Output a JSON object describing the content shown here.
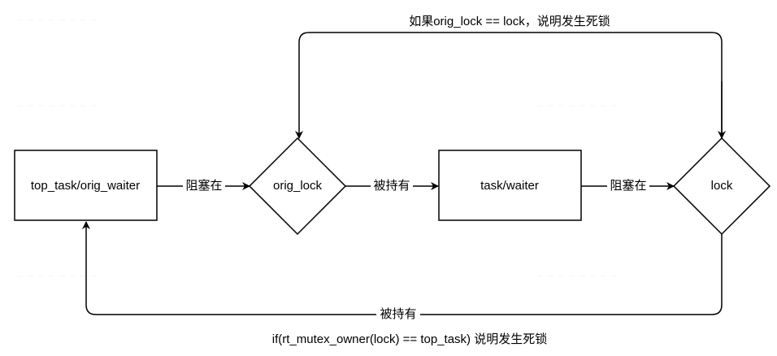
{
  "nodes": {
    "top_task": {
      "label": "top_task/orig_waiter",
      "shape": "rectangle"
    },
    "orig_lock": {
      "label": "orig_lock",
      "shape": "diamond"
    },
    "task_waiter": {
      "label": "task/waiter",
      "shape": "rectangle"
    },
    "lock": {
      "label": "lock",
      "shape": "diamond"
    }
  },
  "edges": {
    "blocked_on_1": {
      "label": "阻塞在"
    },
    "held_by_1": {
      "label": "被持有"
    },
    "blocked_on_2": {
      "label": "阻塞在"
    },
    "held_by_return": {
      "label": "被持有"
    },
    "deadlock_top": {
      "label": "如果orig_lock == lock，说明发生死锁"
    }
  },
  "caption": "if(rt_mutex_owner(lock) == top_task) 说明发生死锁",
  "colors": {
    "stroke": "#000000",
    "background": "#ffffff"
  }
}
